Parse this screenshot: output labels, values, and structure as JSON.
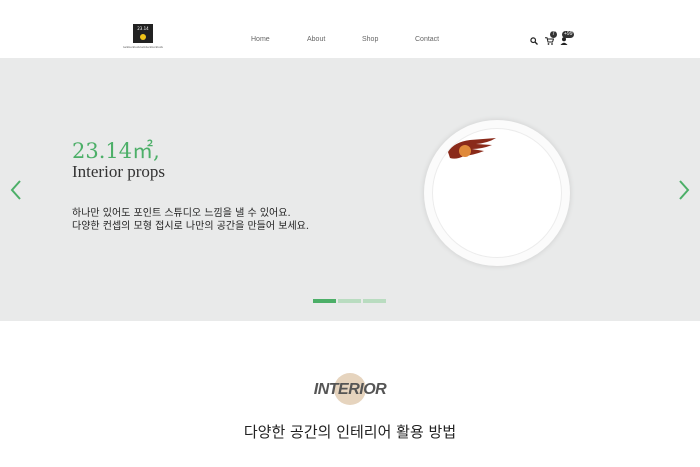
{
  "header": {
    "logo_text": "23.14",
    "logo_sub": "luckluckluckluckluckluckluck",
    "nav": [
      "Home",
      "About",
      "Shop",
      "Contact"
    ],
    "cart_count": "7",
    "user_count": "+99",
    "icons": [
      "search-icon",
      "cart-icon",
      "user-icon"
    ]
  },
  "hero": {
    "number": "23.14㎡,",
    "subtitle": "Interior props",
    "desc_line1": "하나만 있어도 포인트 스튜디오 느낌을 낼 수 있어요.",
    "desc_line2": "다양한 컨셉의 모형 접시로 나만의 공간을 만들어 보세요.",
    "accent": "#4caf68",
    "slides": 3,
    "active_slide": 1
  },
  "section": {
    "badge": "INTERIOR",
    "title": "다양한 공간의 인테리어 활용 방법"
  }
}
